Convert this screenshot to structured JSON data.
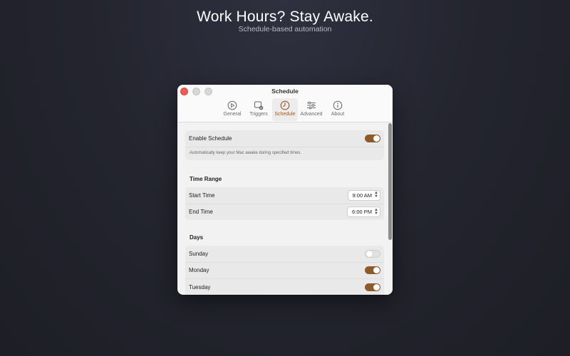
{
  "hero": {
    "title": "Work Hours? Stay Awake.",
    "subtitle": "Schedule-based automation"
  },
  "window": {
    "title": "Schedule",
    "tabs": [
      {
        "label": "General",
        "icon": "gauge-icon",
        "active": false
      },
      {
        "label": "Triggers",
        "icon": "triggers-icon",
        "active": false
      },
      {
        "label": "Schedule",
        "icon": "clock-icon",
        "active": true
      },
      {
        "label": "Advanced",
        "icon": "sliders-icon",
        "active": false
      },
      {
        "label": "About",
        "icon": "info-icon",
        "active": false
      }
    ]
  },
  "enable": {
    "label": "Enable Schedule",
    "enabled": true,
    "description": "Automatically keep your Mac awake during specified times."
  },
  "time_range": {
    "title": "Time Range",
    "start_label": "Start Time",
    "start_value": "9:00 AM",
    "end_label": "End Time",
    "end_value": "6:00 PM"
  },
  "days": {
    "title": "Days",
    "items": [
      {
        "label": "Sunday",
        "on": false
      },
      {
        "label": "Monday",
        "on": true
      },
      {
        "label": "Tuesday",
        "on": true
      }
    ]
  },
  "colors": {
    "accent": "#8e5a2b",
    "close_button": "#ee5d55"
  }
}
